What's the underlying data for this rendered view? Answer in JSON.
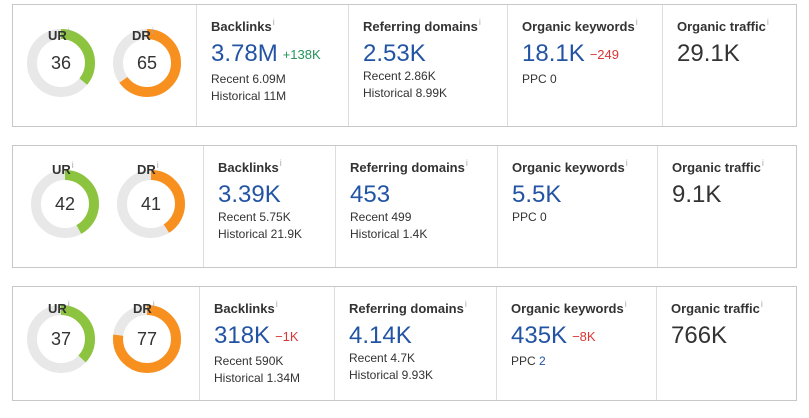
{
  "info_glyph": "i",
  "colors": {
    "ur": "#8cc43f",
    "dr": "#f7901e",
    "track": "#e8e8e8",
    "link": "#2354a3",
    "up": "#23945a",
    "down": "#d93636"
  },
  "cards": [
    {
      "ur": {
        "label": "UR",
        "value": "36",
        "fraction": 0.36
      },
      "dr": {
        "label": "DR",
        "value": "65",
        "fraction": 0.65
      },
      "backlinks": {
        "title": "Backlinks",
        "value": "3.78M",
        "delta": "+138K",
        "recent": "Recent 6.09M",
        "historical": "Historical 11M"
      },
      "referring": {
        "title": "Referring domains",
        "value": "2.53K",
        "recent": "Recent 2.86K",
        "historical": "Historical 8.99K"
      },
      "keywords": {
        "title": "Organic keywords",
        "value": "18.1K",
        "delta": "−249",
        "ppc_label": "PPC",
        "ppc_value": "0"
      },
      "traffic": {
        "title": "Organic traffic",
        "value": "29.1K"
      }
    },
    {
      "ur": {
        "label": "UR",
        "value": "42",
        "fraction": 0.42
      },
      "dr": {
        "label": "DR",
        "value": "41",
        "fraction": 0.41
      },
      "backlinks": {
        "title": "Backlinks",
        "value": "3.39K",
        "delta": "",
        "recent": "Recent 5.75K",
        "historical": "Historical 21.9K"
      },
      "referring": {
        "title": "Referring domains",
        "value": "453",
        "recent": "Recent 499",
        "historical": "Historical 1.4K"
      },
      "keywords": {
        "title": "Organic keywords",
        "value": "5.5K",
        "delta": "",
        "ppc_label": "PPC",
        "ppc_value": "0"
      },
      "traffic": {
        "title": "Organic traffic",
        "value": "9.1K"
      }
    },
    {
      "ur": {
        "label": "UR",
        "value": "37",
        "fraction": 0.37
      },
      "dr": {
        "label": "DR",
        "value": "77",
        "fraction": 0.77
      },
      "backlinks": {
        "title": "Backlinks",
        "value": "318K",
        "delta": "−1K",
        "recent": "Recent 590K",
        "historical": "Historical 1.34M"
      },
      "referring": {
        "title": "Referring domains",
        "value": "4.14K",
        "recent": "Recent 4.7K",
        "historical": "Historical 9.93K"
      },
      "keywords": {
        "title": "Organic keywords",
        "value": "435K",
        "delta": "−8K",
        "ppc_label": "PPC",
        "ppc_value": "2"
      },
      "traffic": {
        "title": "Organic traffic",
        "value": "766K"
      }
    }
  ]
}
